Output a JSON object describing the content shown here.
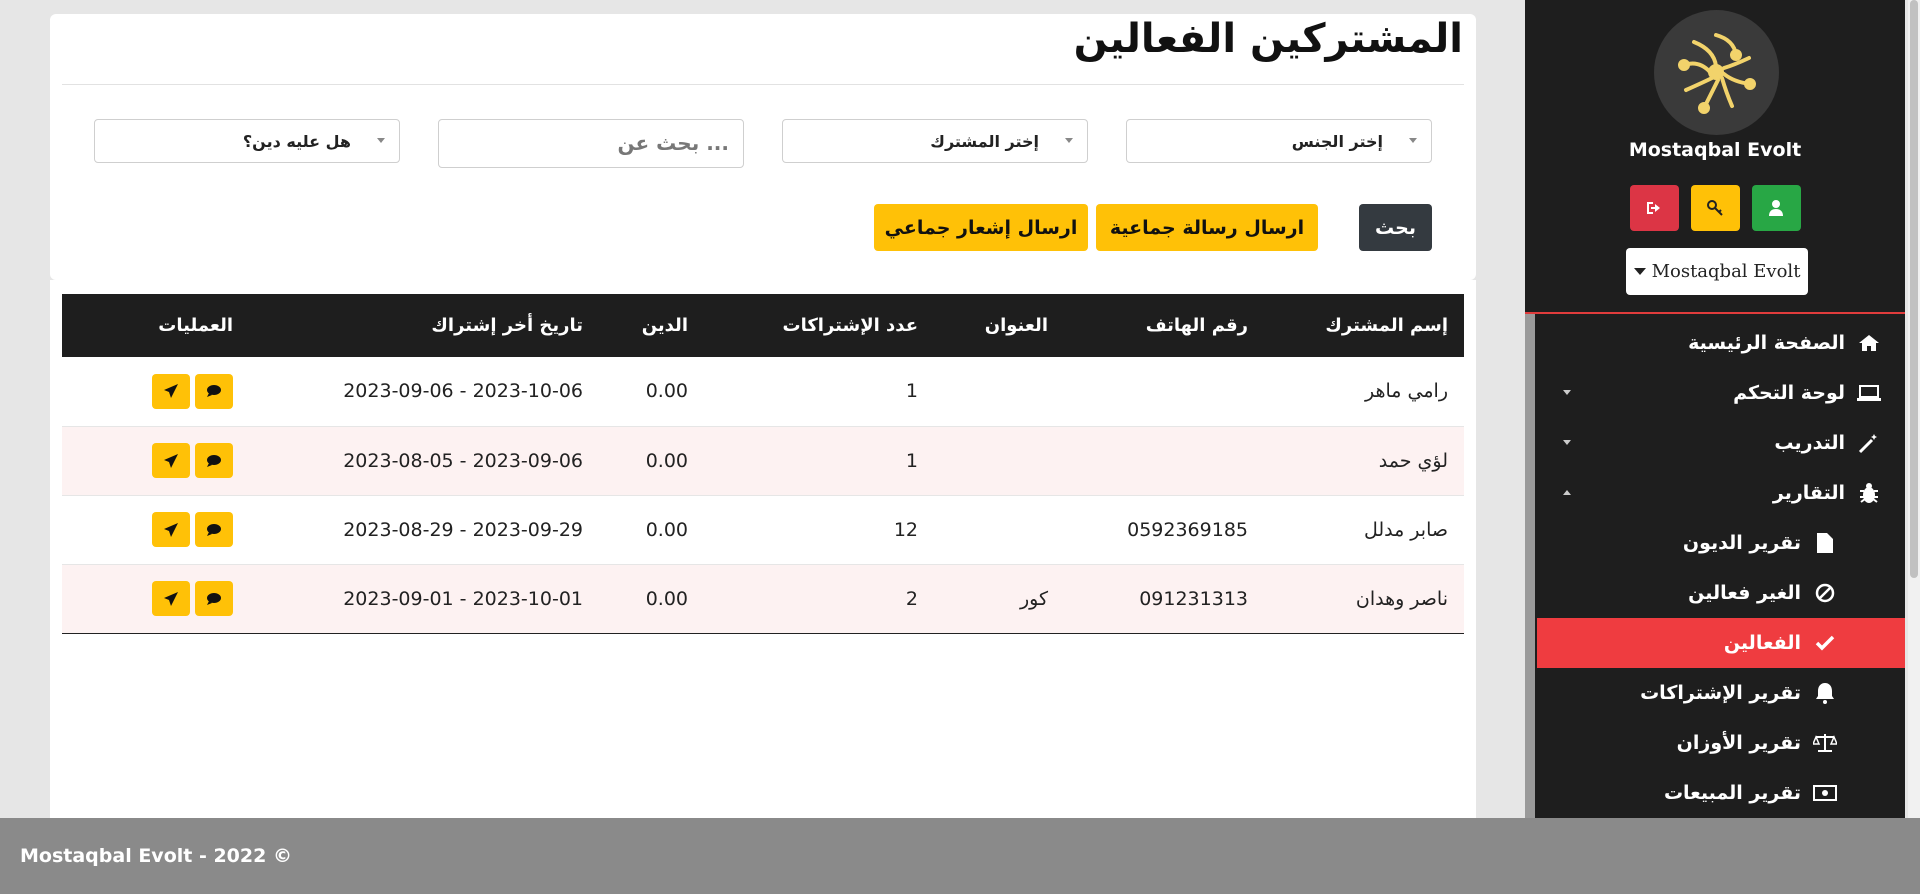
{
  "sidebar": {
    "brand": "Mostaqbal Evolt",
    "dropdown_label": "Mostaqbal Evolt",
    "buttons": [
      {
        "icon": "sign-out-icon",
        "color": "#dc3545"
      },
      {
        "icon": "key-icon",
        "color": "#ffc107"
      },
      {
        "icon": "user-icon",
        "color": "#28a745"
      }
    ],
    "items": [
      {
        "label": "الصفحة الرئيسية",
        "icon": "home-icon"
      },
      {
        "label": "لوحة التحكم",
        "icon": "laptop-icon",
        "arrow": "down"
      },
      {
        "label": "التدريب",
        "icon": "magic-wand-icon",
        "arrow": "down"
      },
      {
        "label": "التقارير",
        "icon": "bug-icon",
        "arrow": "up"
      },
      {
        "label": "تقرير الديون",
        "icon": "file-icon"
      },
      {
        "label": "الغير فعالين",
        "icon": "ban-icon"
      },
      {
        "label": "الفعالين",
        "icon": "check-icon",
        "active": true
      },
      {
        "label": "تقرير الإشتراكات",
        "icon": "bell-icon"
      },
      {
        "label": "تقرير الأوزان",
        "icon": "balance-scale-icon"
      },
      {
        "label": "تقرير المبيعات",
        "icon": "money-icon"
      }
    ]
  },
  "page": {
    "title": "المشتركين الفعالين"
  },
  "filters": {
    "gender_placeholder": "إختر الجنس",
    "subscriber_placeholder": "إختر المشترك",
    "search_placeholder": "بحث عن ...",
    "debt_placeholder": "هل عليه دين؟"
  },
  "actions": {
    "search": "بحث",
    "group_message": "ارسال رسالة جماعية",
    "group_notify": "ارسال إشعار جماعي"
  },
  "table": {
    "headers": [
      "إسم المشترك",
      "رقم الهاتف",
      "العنوان",
      "عدد الإشتراكات",
      "الدين",
      "تاريخ أخر إشتراك",
      "العمليات"
    ],
    "rows": [
      {
        "name": "رامي ماهر",
        "phone": "",
        "address": "",
        "subs": "1",
        "debt": "0.00",
        "last": "2023-10-06 - 2023-09-06"
      },
      {
        "name": "لؤي حمد",
        "phone": "",
        "address": "",
        "subs": "1",
        "debt": "0.00",
        "last": "2023-09-06 - 2023-08-05"
      },
      {
        "name": "صابر مدلل",
        "phone": "0592369185",
        "address": "",
        "subs": "12",
        "debt": "0.00",
        "last": "2023-09-29 - 2023-08-29"
      },
      {
        "name": "ناصر وهدان",
        "phone": "091231313",
        "address": "كور",
        "subs": "2",
        "debt": "0.00",
        "last": "2023-10-01 - 2023-09-01"
      }
    ]
  },
  "footer": {
    "text": "Mostaqbal Evolt - 2022 ©"
  },
  "colors": {
    "accent_red": "#ef3c40",
    "yellow": "#ffc107",
    "dark": "#1e1e1e"
  }
}
